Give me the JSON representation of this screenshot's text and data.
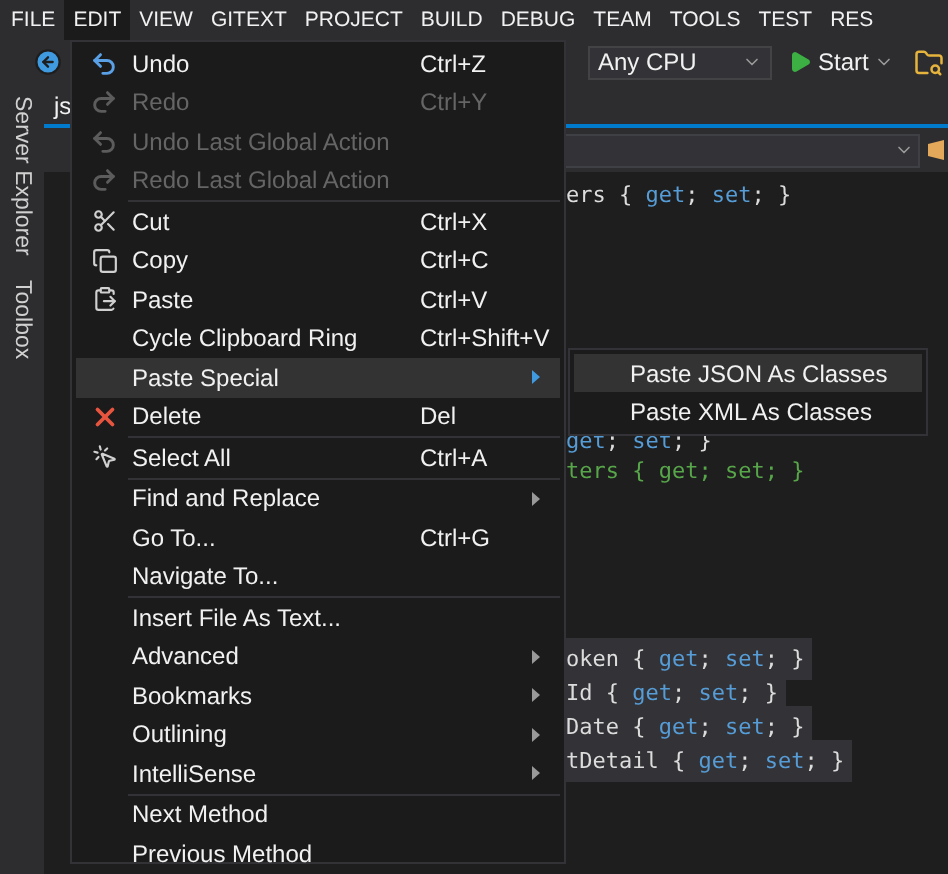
{
  "menu_bar": [
    {
      "label": "FILE",
      "selected": false
    },
    {
      "label": "EDIT",
      "selected": true
    },
    {
      "label": "VIEW",
      "selected": false
    },
    {
      "label": "GITEXT",
      "selected": false
    },
    {
      "label": "PROJECT",
      "selected": false
    },
    {
      "label": "BUILD",
      "selected": false
    },
    {
      "label": "DEBUG",
      "selected": false
    },
    {
      "label": "TEAM",
      "selected": false
    },
    {
      "label": "TOOLS",
      "selected": false
    },
    {
      "label": "TEST",
      "selected": false
    },
    {
      "label": "RES",
      "selected": false
    }
  ],
  "toolbar": {
    "platform": "Any CPU",
    "start": "Start"
  },
  "side_tabs": [
    "Server Explorer",
    "Toolbox"
  ],
  "document_tab": "js",
  "edit_menu": [
    {
      "kind": "item",
      "label": "Undo",
      "shortcut": "Ctrl+Z",
      "disabled": false,
      "selected": false,
      "submenu": false
    },
    {
      "kind": "item",
      "label": "Redo",
      "shortcut": "Ctrl+Y",
      "disabled": true,
      "selected": false,
      "submenu": false
    },
    {
      "kind": "item",
      "label": "Undo Last Global Action",
      "disabled": true,
      "selected": false,
      "submenu": false
    },
    {
      "kind": "item",
      "label": "Redo Last Global Action",
      "disabled": true,
      "selected": false,
      "submenu": false
    },
    {
      "kind": "separator"
    },
    {
      "kind": "item",
      "label": "Cut",
      "shortcut": "Ctrl+X",
      "disabled": false,
      "selected": false,
      "submenu": false
    },
    {
      "kind": "item",
      "label": "Copy",
      "shortcut": "Ctrl+C",
      "disabled": false,
      "selected": false,
      "submenu": false
    },
    {
      "kind": "item",
      "label": "Paste",
      "shortcut": "Ctrl+V",
      "disabled": false,
      "selected": false,
      "submenu": false
    },
    {
      "kind": "item",
      "label": "Cycle Clipboard Ring",
      "shortcut": "Ctrl+Shift+V",
      "disabled": false,
      "selected": false,
      "submenu": false
    },
    {
      "kind": "item",
      "label": "Paste Special",
      "disabled": false,
      "selected": true,
      "submenu": true
    },
    {
      "kind": "item",
      "label": "Delete",
      "shortcut": "Del",
      "disabled": false,
      "selected": false,
      "submenu": false
    },
    {
      "kind": "separator"
    },
    {
      "kind": "item",
      "label": "Select All",
      "shortcut": "Ctrl+A",
      "disabled": false,
      "selected": false,
      "submenu": false
    },
    {
      "kind": "separator"
    },
    {
      "kind": "item",
      "label": "Find and Replace",
      "disabled": false,
      "selected": false,
      "submenu": true
    },
    {
      "kind": "item",
      "label": "Go To...",
      "shortcut": "Ctrl+G",
      "disabled": false,
      "selected": false,
      "submenu": false
    },
    {
      "kind": "item",
      "label": "Navigate To...",
      "disabled": false,
      "selected": false,
      "submenu": false
    },
    {
      "kind": "separator"
    },
    {
      "kind": "item",
      "label": "Insert File As Text...",
      "disabled": false,
      "selected": false,
      "submenu": false
    },
    {
      "kind": "item",
      "label": "Advanced",
      "disabled": false,
      "selected": false,
      "submenu": true
    },
    {
      "kind": "item",
      "label": "Bookmarks",
      "disabled": false,
      "selected": false,
      "submenu": true
    },
    {
      "kind": "item",
      "label": "Outlining",
      "disabled": false,
      "selected": false,
      "submenu": true
    },
    {
      "kind": "item",
      "label": "IntelliSense",
      "disabled": false,
      "selected": false,
      "submenu": true
    },
    {
      "kind": "separator"
    },
    {
      "kind": "item",
      "label": "Next Method",
      "disabled": false,
      "selected": false,
      "submenu": false
    },
    {
      "kind": "item",
      "label": "Previous Method",
      "disabled": false,
      "selected": false,
      "submenu": false
    }
  ],
  "paste_special_menu": [
    {
      "label": "Paste JSON As Classes",
      "selected": true
    },
    {
      "label": "Paste XML As Classes",
      "selected": false
    }
  ],
  "code_lines": [
    {
      "highlighted": false,
      "parts": [
        {
          "text": "ers { ",
          "kind": "plain"
        },
        {
          "text": "get",
          "kind": "keyword"
        },
        {
          "text": "; ",
          "kind": "plain"
        },
        {
          "text": "set",
          "kind": "keyword"
        },
        {
          "text": "; }",
          "kind": "plain"
        }
      ]
    },
    {
      "highlighted": false,
      "parts": [
        {
          "text": "get",
          "kind": "keyword"
        },
        {
          "text": "; ",
          "kind": "plain"
        },
        {
          "text": "set",
          "kind": "keyword"
        },
        {
          "text": "; }",
          "kind": "plain"
        }
      ]
    },
    {
      "highlighted": false,
      "parts": [
        {
          "text": "ters { get; set; }",
          "kind": "comment"
        }
      ]
    },
    {
      "highlighted": true,
      "parts": [
        {
          "text": "oken { ",
          "kind": "plain"
        },
        {
          "text": "get",
          "kind": "keyword"
        },
        {
          "text": "; ",
          "kind": "plain"
        },
        {
          "text": "set",
          "kind": "keyword"
        },
        {
          "text": "; }",
          "kind": "plain"
        }
      ]
    },
    {
      "highlighted": true,
      "parts": [
        {
          "text": "Id { ",
          "kind": "plain"
        },
        {
          "text": "get",
          "kind": "keyword"
        },
        {
          "text": "; ",
          "kind": "plain"
        },
        {
          "text": "set",
          "kind": "keyword"
        },
        {
          "text": "; }",
          "kind": "plain"
        }
      ]
    },
    {
      "highlighted": true,
      "parts": [
        {
          "text": "Date { ",
          "kind": "plain"
        },
        {
          "text": "get",
          "kind": "keyword"
        },
        {
          "text": "; ",
          "kind": "plain"
        },
        {
          "text": "set",
          "kind": "keyword"
        },
        {
          "text": "; }",
          "kind": "plain"
        }
      ]
    },
    {
      "highlighted": true,
      "parts": [
        {
          "text": "tDetail { ",
          "kind": "plain"
        },
        {
          "text": "get",
          "kind": "keyword"
        },
        {
          "text": "; ",
          "kind": "plain"
        },
        {
          "text": "set",
          "kind": "keyword"
        },
        {
          "text": "; }",
          "kind": "plain"
        }
      ]
    }
  ]
}
